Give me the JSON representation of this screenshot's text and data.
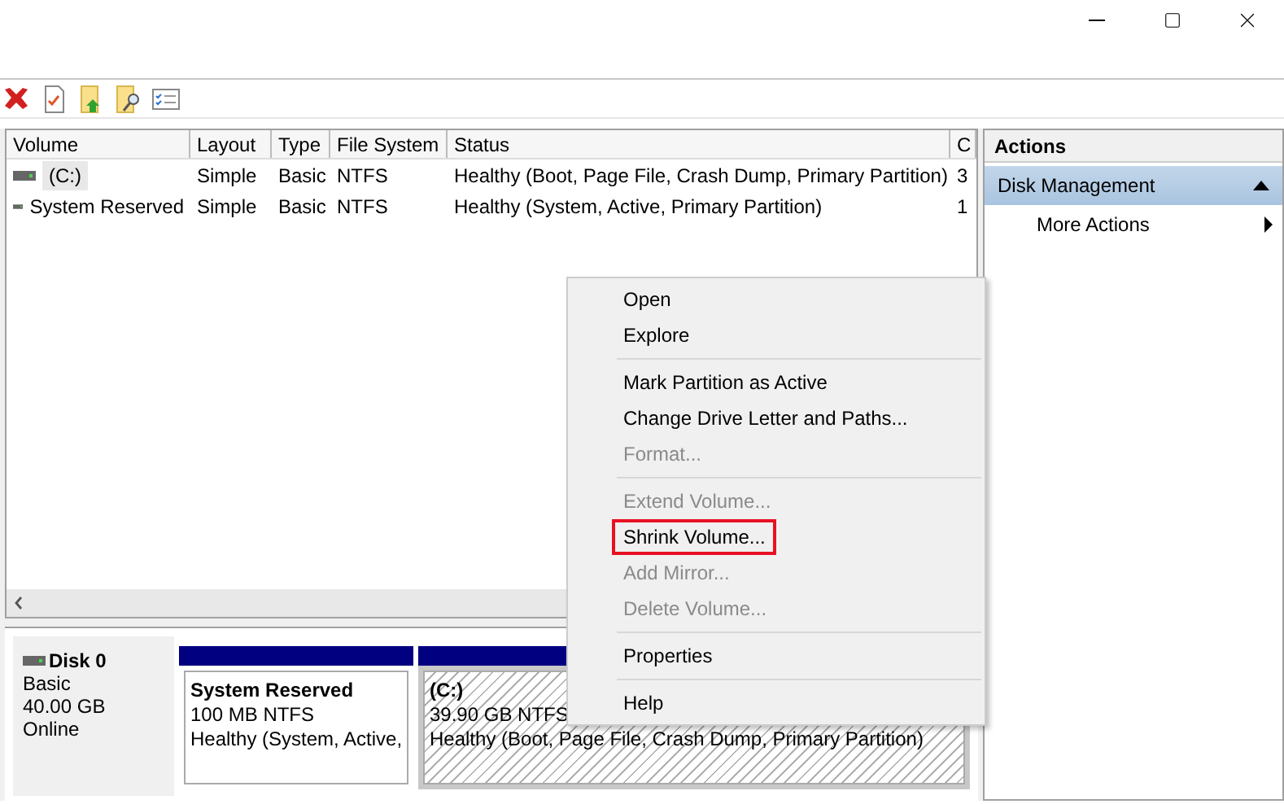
{
  "toolbar": [
    {
      "kind": "delete"
    },
    {
      "kind": "properties"
    },
    {
      "kind": "up"
    },
    {
      "kind": "search"
    },
    {
      "kind": "checklist"
    }
  ],
  "table": {
    "columns": [
      "Volume",
      "Layout",
      "Type",
      "File System",
      "Status",
      "C"
    ],
    "rows": [
      {
        "cells": [
          "(C:)",
          "Simple",
          "Basic",
          "NTFS",
          "Healthy (Boot, Page File, Crash Dump, Primary Partition)",
          "3"
        ],
        "selected": true
      },
      {
        "cells": [
          "System Reserved",
          "Simple",
          "Basic",
          "NTFS",
          "Healthy (System, Active, Primary Partition)",
          "1"
        ],
        "selected": false
      }
    ]
  },
  "disk": {
    "name": "Disk 0",
    "type": "Basic",
    "size": "40.00 GB",
    "status": "Online",
    "partitions": [
      {
        "name": "System Reserved",
        "size": "100 MB NTFS",
        "status": "Healthy (System, Active,",
        "selected": false
      },
      {
        "name": "(C:)",
        "size": "39.90 GB NTFS",
        "status": "Healthy (Boot, Page File, Crash Dump, Primary Partition)",
        "selected": true
      }
    ]
  },
  "actions": {
    "title": "Actions",
    "section": {
      "label": "Disk Management",
      "expanded": true
    },
    "items": [
      {
        "label": "More Actions"
      }
    ]
  },
  "context_menu": [
    {
      "kind": "item",
      "label": "Open",
      "disabled": false,
      "outlined": false
    },
    {
      "kind": "item",
      "label": "Explore",
      "disabled": false,
      "outlined": false
    },
    {
      "kind": "separator"
    },
    {
      "kind": "item",
      "label": "Mark Partition as Active",
      "disabled": false,
      "outlined": false
    },
    {
      "kind": "item",
      "label": "Change Drive Letter and Paths...",
      "disabled": false,
      "outlined": false
    },
    {
      "kind": "item",
      "label": "Format...",
      "disabled": true,
      "outlined": false
    },
    {
      "kind": "separator"
    },
    {
      "kind": "item",
      "label": "Extend Volume...",
      "disabled": true,
      "outlined": false
    },
    {
      "kind": "item",
      "label": "Shrink Volume...",
      "disabled": false,
      "outlined": true
    },
    {
      "kind": "item",
      "label": "Add Mirror...",
      "disabled": true,
      "outlined": false
    },
    {
      "kind": "item",
      "label": "Delete Volume...",
      "disabled": true,
      "outlined": false
    },
    {
      "kind": "separator"
    },
    {
      "kind": "item",
      "label": "Properties",
      "disabled": false,
      "outlined": false
    },
    {
      "kind": "separator"
    },
    {
      "kind": "item",
      "label": "Help",
      "disabled": false,
      "outlined": false
    }
  ]
}
